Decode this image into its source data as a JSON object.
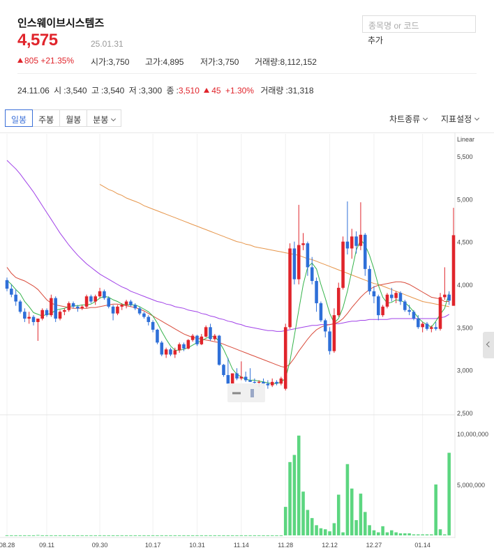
{
  "stock": {
    "name": "인스웨이브시스템즈",
    "price": "4,575",
    "date": "25.01.31",
    "change": "805",
    "change_pct": "+21.35%",
    "open_label": "시가",
    "open": "3,750",
    "high_label": "고가",
    "high": "4,895",
    "low_label": "저가",
    "low": "3,750",
    "volume_label": "거래량",
    "volume": "8,112,152"
  },
  "search": {
    "placeholder": "종목명 or 코드",
    "add_label": "추가"
  },
  "prev": {
    "date": "24.11.06",
    "o_label": "시",
    "o": "3,540",
    "h_label": "고",
    "h": "3,540",
    "l_label": "저",
    "l": "3,300",
    "c_label": "종",
    "c": "3,510",
    "chg": "45",
    "chg_pct": "+1.30%",
    "v_label": "거래량",
    "v": "31,318"
  },
  "tabs": [
    {
      "label": "일봉"
    },
    {
      "label": "주봉"
    },
    {
      "label": "월봉"
    },
    {
      "label": "분봉"
    }
  ],
  "menu": {
    "chart_type": "차트종류",
    "indicators": "지표설정"
  },
  "colors": {
    "up": "#e0242b",
    "down": "#2e6fd8",
    "volume": "#5cd680",
    "ma5": "#34b34a",
    "ma20": "#d94a3a",
    "ma60": "#a040e8",
    "ma120": "#e6954a"
  },
  "chart_data": {
    "type": "candlestick",
    "scale_label": "Linear",
    "price_ticks": [
      2500,
      3000,
      3500,
      4000,
      4500,
      5000,
      5500
    ],
    "price_tick_labels": [
      "2,500",
      "3,000",
      "3,500",
      "4,000",
      "4,500",
      "5,000",
      "5,500"
    ],
    "volume_ticks": [
      5000000,
      10000000
    ],
    "volume_tick_labels": [
      "5,000,000",
      "10,000,000"
    ],
    "x_labels": [
      "08.28",
      "09.11",
      "09.30",
      "10.17",
      "10.31",
      "11.14",
      "11.28",
      "12.12",
      "12.27",
      "01.14"
    ],
    "x_label_index": [
      0,
      9,
      21,
      33,
      43,
      53,
      63,
      73,
      83,
      94
    ],
    "candles": [
      [
        4050,
        4080,
        3920,
        3950
      ],
      [
        3950,
        4000,
        3850,
        3880
      ],
      [
        3880,
        3940,
        3750,
        3800
      ],
      [
        3800,
        3820,
        3660,
        3680
      ],
      [
        3680,
        3720,
        3560,
        3600
      ],
      [
        3600,
        3680,
        3540,
        3620
      ],
      [
        3620,
        3640,
        3520,
        3560
      ],
      [
        3560,
        3580,
        3340,
        3600
      ],
      [
        3600,
        3720,
        3580,
        3700
      ],
      [
        3700,
        3720,
        3620,
        3640
      ],
      [
        3640,
        3880,
        3620,
        3840
      ],
      [
        3840,
        3860,
        3560,
        3600
      ],
      [
        3600,
        3700,
        3580,
        3680
      ],
      [
        3680,
        3720,
        3640,
        3700
      ],
      [
        3700,
        3800,
        3680,
        3780
      ],
      [
        3780,
        3800,
        3720,
        3740
      ],
      [
        3740,
        3760,
        3680,
        3720
      ],
      [
        3720,
        3760,
        3700,
        3740
      ],
      [
        3740,
        3880,
        3720,
        3860
      ],
      [
        3860,
        3880,
        3780,
        3800
      ],
      [
        3800,
        3880,
        3760,
        3860
      ],
      [
        3860,
        3960,
        3840,
        3920
      ],
      [
        3920,
        3940,
        3820,
        3840
      ],
      [
        3840,
        3860,
        3720,
        3740
      ],
      [
        3740,
        3760,
        3580,
        3660
      ],
      [
        3660,
        3760,
        3640,
        3740
      ],
      [
        3740,
        3780,
        3700,
        3760
      ],
      [
        3760,
        3820,
        3720,
        3800
      ],
      [
        3800,
        3820,
        3740,
        3760
      ],
      [
        3760,
        3780,
        3700,
        3720
      ],
      [
        3720,
        3740,
        3640,
        3660
      ],
      [
        3660,
        3680,
        3600,
        3620
      ],
      [
        3620,
        3640,
        3520,
        3560
      ],
      [
        3560,
        3580,
        3440,
        3470
      ],
      [
        3470,
        3480,
        3300,
        3320
      ],
      [
        3320,
        3340,
        3160,
        3180
      ],
      [
        3180,
        3260,
        3140,
        3240
      ],
      [
        3240,
        3260,
        3160,
        3180
      ],
      [
        3180,
        3260,
        3140,
        3230
      ],
      [
        3230,
        3320,
        3200,
        3300
      ],
      [
        3300,
        3320,
        3220,
        3250
      ],
      [
        3250,
        3360,
        3240,
        3350
      ],
      [
        3350,
        3420,
        3330,
        3400
      ],
      [
        3400,
        3410,
        3280,
        3300
      ],
      [
        3300,
        3420,
        3290,
        3390
      ],
      [
        3390,
        3520,
        3380,
        3500
      ],
      [
        3500,
        3540,
        3340,
        3360
      ],
      [
        3360,
        3420,
        3340,
        3400
      ],
      [
        3400,
        3410,
        3050,
        3060
      ],
      [
        3060,
        3070,
        2920,
        2940
      ],
      [
        2940,
        3140,
        2900,
        2840
      ],
      [
        2840,
        2960,
        2820,
        2960
      ],
      [
        2960,
        3020,
        2880,
        2900
      ],
      [
        2900,
        3100,
        2880,
        2920
      ],
      [
        2920,
        2980,
        2860,
        2880
      ],
      [
        2880,
        3020,
        2860,
        2860
      ],
      [
        2860,
        2900,
        2840,
        2850
      ],
      [
        2850,
        2880,
        2800,
        2860
      ],
      [
        2860,
        2900,
        2820,
        2840
      ],
      [
        2840,
        2880,
        2780,
        2820
      ],
      [
        2820,
        2900,
        2800,
        2860
      ],
      [
        2860,
        2880,
        2820,
        2840
      ],
      [
        2840,
        2920,
        2820,
        2900
      ],
      [
        2780,
        3540,
        2760,
        3500
      ],
      [
        3500,
        4480,
        3480,
        4420
      ],
      [
        4420,
        4500,
        4000,
        4060
      ],
      [
        4060,
        4930,
        4000,
        4460
      ],
      [
        4460,
        4600,
        4400,
        4480
      ],
      [
        4480,
        4500,
        4100,
        4200
      ],
      [
        4200,
        4320,
        4000,
        4040
      ],
      [
        4040,
        4080,
        3680,
        3780
      ],
      [
        3780,
        3800,
        3560,
        3580
      ],
      [
        3580,
        3600,
        3380,
        3450
      ],
      [
        3450,
        3500,
        3180,
        3220
      ],
      [
        3220,
        3720,
        3200,
        3640
      ],
      [
        3640,
        4020,
        3620,
        3960
      ],
      [
        3960,
        4560,
        3940,
        4500
      ],
      [
        4500,
        4970,
        4350,
        4420
      ],
      [
        4420,
        4650,
        4300,
        4560
      ],
      [
        4560,
        4620,
        4360,
        4450
      ],
      [
        4450,
        4960,
        4400,
        4580
      ],
      [
        4580,
        4600,
        4100,
        4180
      ],
      [
        4180,
        4220,
        3880,
        3920
      ],
      [
        3920,
        3980,
        3780,
        3860
      ],
      [
        3860,
        3880,
        3580,
        3640
      ],
      [
        3640,
        3760,
        3620,
        3740
      ],
      [
        3740,
        3900,
        3720,
        3880
      ],
      [
        3880,
        3960,
        3800,
        3840
      ],
      [
        3840,
        3920,
        3780,
        3900
      ],
      [
        3900,
        3920,
        3760,
        3800
      ],
      [
        3800,
        3820,
        3680,
        3700
      ],
      [
        3700,
        3760,
        3640,
        3680
      ],
      [
        3680,
        3700,
        3580,
        3600
      ],
      [
        3600,
        3640,
        3480,
        3500
      ],
      [
        3500,
        3560,
        3440,
        3540
      ],
      [
        3540,
        3560,
        3460,
        3480
      ],
      [
        3480,
        3520,
        3440,
        3500
      ],
      [
        3500,
        3560,
        3460,
        3480
      ],
      [
        3480,
        3900,
        3460,
        3850
      ],
      [
        3850,
        4200,
        3820,
        3880
      ],
      [
        3880,
        3920,
        3760,
        3810
      ],
      [
        3750,
        4895,
        3750,
        4575
      ]
    ],
    "volumes": [
      10000,
      10000,
      10000,
      10000,
      10000,
      10000,
      10000,
      40000,
      10000,
      10000,
      10000,
      10000,
      10000,
      10000,
      10000,
      10000,
      10000,
      10000,
      10000,
      10000,
      10000,
      10000,
      10000,
      10000,
      10000,
      10000,
      10000,
      10000,
      10000,
      10000,
      10000,
      10000,
      10000,
      10000,
      10000,
      10000,
      10000,
      10000,
      10000,
      10000,
      10000,
      10000,
      10000,
      10000,
      10000,
      10000,
      10000,
      10000,
      10000,
      10000,
      10000,
      10000,
      10000,
      10000,
      10000,
      10000,
      10000,
      10000,
      10000,
      10000,
      10000,
      10000,
      10000,
      2800000,
      7200000,
      7900000,
      9800000,
      4300000,
      2500000,
      1700000,
      1000000,
      700000,
      600000,
      400000,
      1200000,
      4000000,
      300000,
      7000000,
      4600000,
      1500000,
      4100000,
      2300000,
      1000000,
      500000,
      300000,
      900000,
      300000,
      500000,
      300000,
      200000,
      200000,
      200000,
      100000,
      100000,
      100000,
      100000,
      100000,
      5000000,
      600000,
      100000,
      8112152
    ],
    "ma5": [
      4050,
      4000,
      3940,
      3890,
      3800,
      3740,
      3670,
      3650,
      3630,
      3650,
      3660,
      3700,
      3710,
      3720,
      3740,
      3750,
      3750,
      3760,
      3760,
      3770,
      3800,
      3840,
      3860,
      3850,
      3820,
      3800,
      3770,
      3760,
      3760,
      3760,
      3740,
      3710,
      3680,
      3630,
      3550,
      3450,
      3360,
      3280,
      3230,
      3230,
      3240,
      3260,
      3290,
      3320,
      3340,
      3370,
      3390,
      3390,
      3330,
      3240,
      3130,
      3010,
      2950,
      2920,
      2890,
      2880,
      2880,
      2870,
      2860,
      2850,
      2840,
      2840,
      2860,
      2900,
      3100,
      3400,
      3700,
      4000,
      4200,
      4250,
      4180,
      4000,
      3840,
      3660,
      3550,
      3600,
      3730,
      3920,
      4160,
      4400,
      4520,
      4460,
      4340,
      4180,
      3990,
      3850,
      3780,
      3790,
      3820,
      3810,
      3790,
      3740,
      3680,
      3610,
      3560,
      3530,
      3500,
      3570,
      3650,
      3720,
      3900
    ],
    "ma20": [
      4200,
      4130,
      4080,
      4060,
      4040,
      4010,
      3980,
      3940,
      3880,
      3820,
      3780,
      3760,
      3750,
      3740,
      3730,
      3720,
      3720,
      3720,
      3720,
      3730,
      3730,
      3740,
      3750,
      3760,
      3770,
      3770,
      3760,
      3750,
      3740,
      3730,
      3710,
      3690,
      3660,
      3630,
      3600,
      3570,
      3540,
      3510,
      3480,
      3450,
      3420,
      3400,
      3380,
      3370,
      3360,
      3350,
      3340,
      3330,
      3320,
      3300,
      3280,
      3260,
      3240,
      3220,
      3200,
      3180,
      3160,
      3140,
      3120,
      3100,
      3080,
      3060,
      3040,
      3030,
      3070,
      3140,
      3220,
      3290,
      3360,
      3420,
      3470,
      3500,
      3520,
      3530,
      3540,
      3560,
      3600,
      3660,
      3730,
      3790,
      3850,
      3900,
      3940,
      3970,
      3990,
      4000,
      4010,
      4020,
      4030,
      4030,
      4020,
      4000,
      3970,
      3940,
      3910,
      3880,
      3850,
      3840,
      3830,
      3800,
      3800
    ],
    "ma60": [
      5450,
      5400,
      5350,
      5290,
      5220,
      5150,
      5080,
      5000,
      4920,
      4840,
      4760,
      4680,
      4600,
      4530,
      4460,
      4400,
      4340,
      4290,
      4240,
      4200,
      4160,
      4120,
      4090,
      4060,
      4030,
      4000,
      3970,
      3950,
      3920,
      3900,
      3880,
      3860,
      3840,
      3820,
      3800,
      3790,
      3770,
      3760,
      3740,
      3730,
      3720,
      3700,
      3690,
      3680,
      3660,
      3650,
      3630,
      3620,
      3600,
      3590,
      3570,
      3560,
      3540,
      3530,
      3510,
      3500,
      3490,
      3480,
      3470,
      3460,
      3460,
      3450,
      3450,
      3460,
      3470,
      3480,
      3490,
      3500,
      3510,
      3520,
      3520,
      3530,
      3530,
      3530,
      3540,
      3540,
      3550,
      3560,
      3570,
      3570,
      3580,
      3580,
      3590,
      3590,
      3590,
      3590,
      3590,
      3600,
      3600,
      3600,
      3600,
      3600,
      3600,
      3600,
      3600,
      3600,
      3600,
      3600,
      3610,
      3620,
      3650
    ],
    "ma120": [
      null,
      null,
      null,
      null,
      null,
      null,
      null,
      null,
      null,
      null,
      null,
      null,
      null,
      null,
      null,
      null,
      null,
      null,
      null,
      null,
      null,
      5170,
      5140,
      5110,
      5090,
      5060,
      5040,
      5010,
      4990,
      4970,
      4950,
      4920,
      4900,
      4880,
      4860,
      4840,
      4820,
      4800,
      4780,
      4760,
      4740,
      4720,
      4700,
      4680,
      4660,
      4640,
      4620,
      4600,
      4580,
      4560,
      4540,
      4520,
      4500,
      4490,
      4470,
      4460,
      4440,
      4430,
      4420,
      4410,
      4400,
      4390,
      4380,
      4370,
      4360,
      4350,
      4340,
      4320,
      4300,
      4290,
      4270,
      4250,
      4230,
      4210,
      4190,
      4170,
      4150,
      4130,
      4110,
      4090,
      4070,
      4050,
      4030,
      4010,
      4000,
      3980,
      3960,
      3940,
      3920,
      3900,
      3880,
      3860,
      3840,
      3820,
      3800,
      3790,
      3780,
      3770,
      3760,
      3750,
      3740
    ]
  }
}
